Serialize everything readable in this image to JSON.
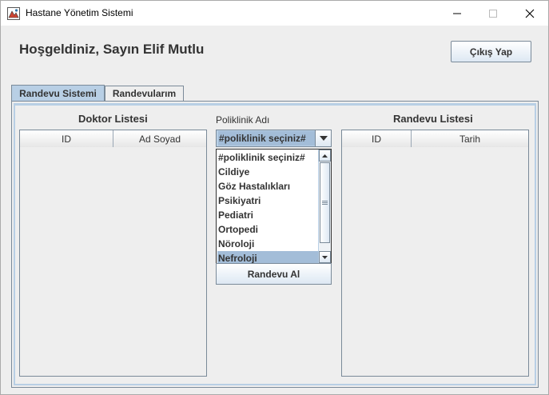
{
  "window": {
    "title": "Hastane Yönetim Sistemi",
    "icon": "app-icon",
    "controls": [
      "minimize-icon",
      "maximize-icon",
      "close-icon"
    ]
  },
  "header": {
    "welcome": "Hoşgeldiniz, Sayın Elif Mutlu",
    "logout_label": "Çıkış Yap"
  },
  "tabs": [
    {
      "label": "Randevu Sistemi",
      "active": true
    },
    {
      "label": "Randevularım",
      "active": false
    }
  ],
  "doctor_panel": {
    "title": "Doktor Listesi",
    "columns": [
      "ID",
      "Ad Soyad"
    ],
    "rows": []
  },
  "clinic_panel": {
    "label": "Poliklinik Adı",
    "selected": "#poliklinik seçiniz#",
    "options": [
      "#poliklinik seçiniz#",
      "Cildiye",
      "Göz Hastalıkları",
      "Psikiyatri",
      "Pediatri",
      "Ortopedi",
      "Nöroloji",
      "Nefroloji"
    ],
    "highlighted": "Nefroloji",
    "button_label": "Randevu Al"
  },
  "appointment_panel": {
    "title": "Randevu Listesi",
    "columns": [
      "ID",
      "Tarih"
    ],
    "rows": []
  },
  "colors": {
    "accent": "#b8cfe5",
    "selection": "#a3bdd8",
    "background": "#eeeeee",
    "border": "#7a8a99"
  }
}
